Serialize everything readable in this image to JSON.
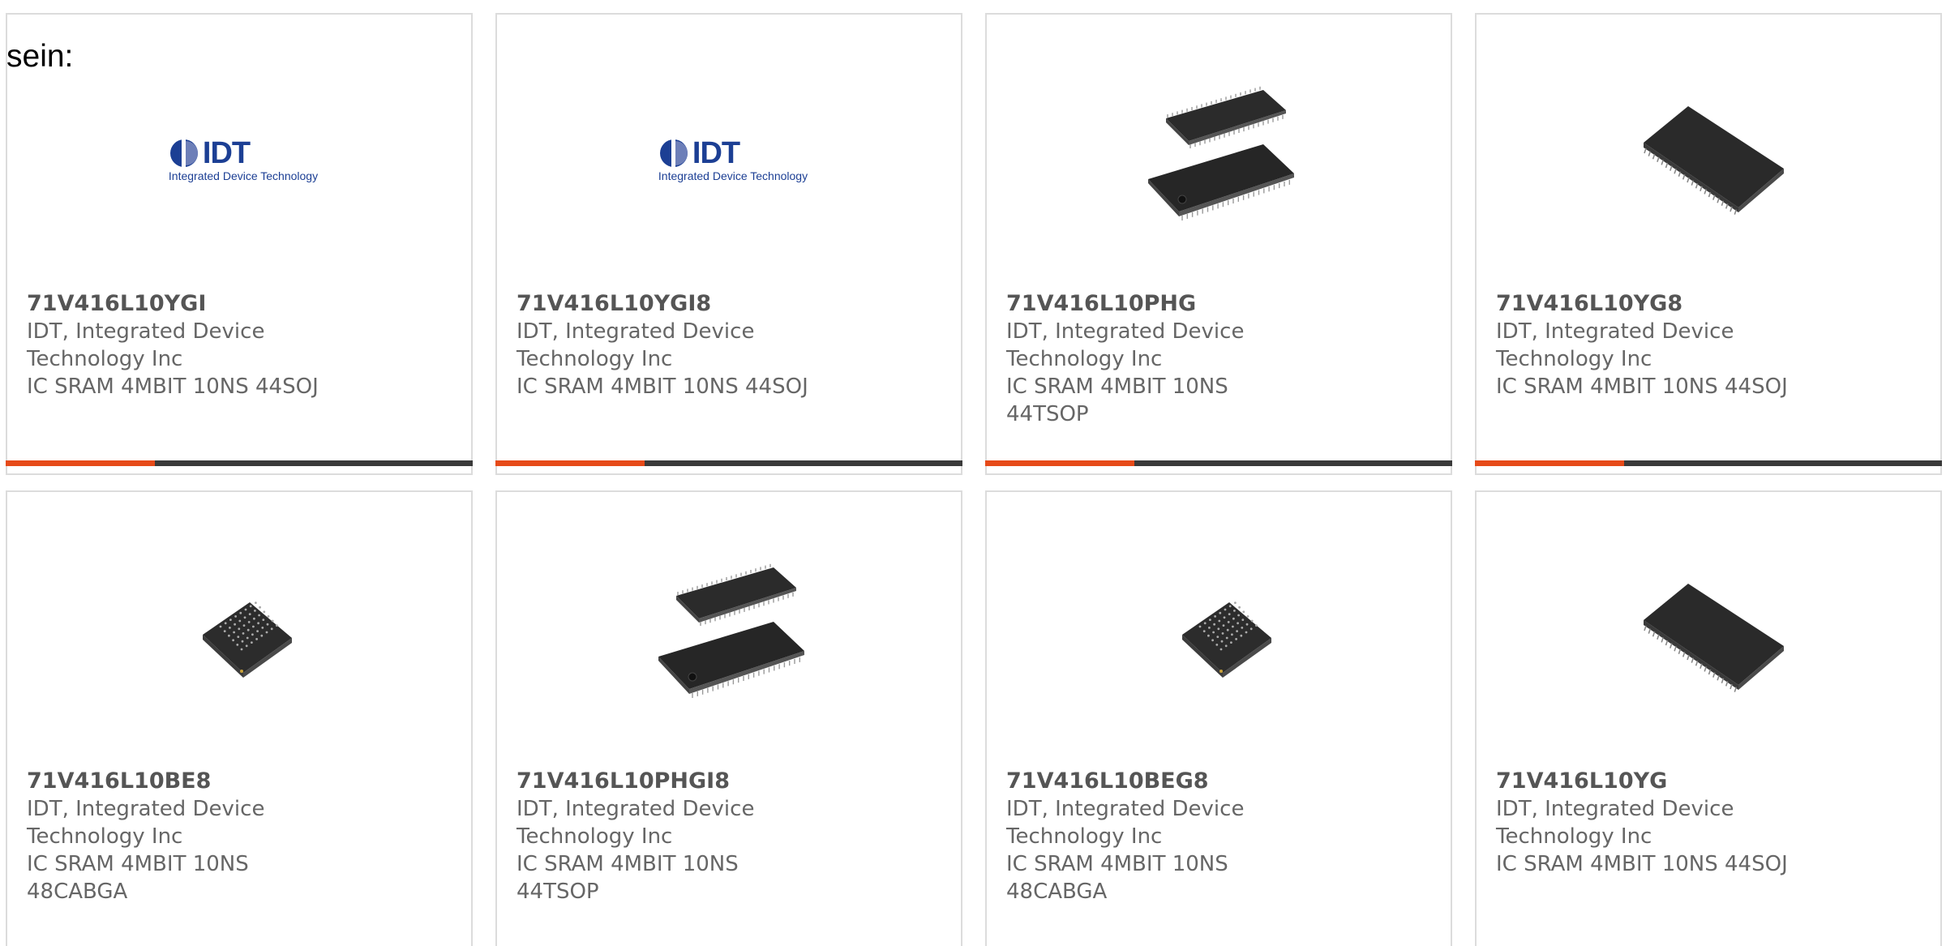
{
  "intro_text": "sein:",
  "accent_color": "#e64a19",
  "cards": [
    {
      "part_number": "71V416L10YGI",
      "manufacturer": "IDT, Integrated Device Technology Inc",
      "description": "IC SRAM 4MBIT 10NS 44SOJ",
      "image": "idt-logo",
      "logo_text": "IDT",
      "logo_sub": "Integrated Device Technology"
    },
    {
      "part_number": "71V416L10YGI8",
      "manufacturer": "IDT, Integrated Device Technology Inc",
      "description": "IC SRAM 4MBIT 10NS 44SOJ",
      "image": "idt-logo",
      "logo_text": "IDT",
      "logo_sub": "Integrated Device Technology"
    },
    {
      "part_number": "71V416L10PHG",
      "manufacturer": "IDT, Integrated Device Technology Inc",
      "description": "IC SRAM 4MBIT 10NS 44TSOP",
      "image": "tsop-chip"
    },
    {
      "part_number": "71V416L10YG8",
      "manufacturer": "IDT, Integrated Device Technology Inc",
      "description": "IC SRAM 4MBIT 10NS 44SOJ",
      "image": "soj-chip"
    },
    {
      "part_number": "71V416L10BE8",
      "manufacturer": "IDT, Integrated Device Technology Inc",
      "description": "IC SRAM 4MBIT 10NS 48CABGA",
      "image": "bga-chip"
    },
    {
      "part_number": "71V416L10PHGI8",
      "manufacturer": "IDT, Integrated Device Technology Inc",
      "description": "IC SRAM 4MBIT 10NS 44TSOP",
      "image": "tsop-chip"
    },
    {
      "part_number": "71V416L10BEG8",
      "manufacturer": "IDT, Integrated Device Technology Inc",
      "description": "IC SRAM 4MBIT 10NS 48CABGA",
      "image": "bga-chip"
    },
    {
      "part_number": "71V416L10YG",
      "manufacturer": "IDT, Integrated Device Technology Inc",
      "description": "IC SRAM 4MBIT 10NS 44SOJ",
      "image": "soj-chip"
    }
  ]
}
